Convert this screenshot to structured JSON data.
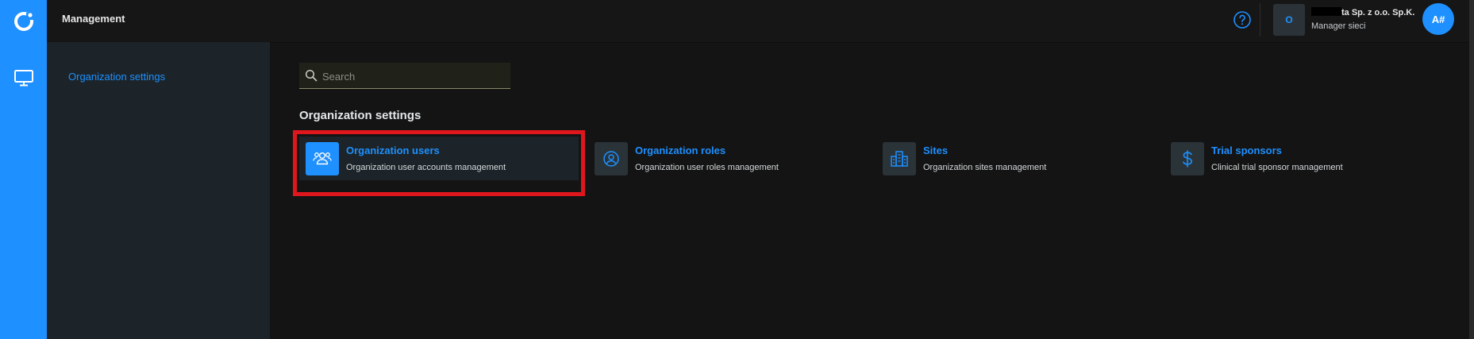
{
  "header": {
    "app_title": "Management",
    "org_initial": "O",
    "org_name": "ta Sp. z o.o. Sp.K.",
    "org_role": "Manager sieci",
    "user_initials": "A#"
  },
  "icons": {
    "logo": "app-logo-icon",
    "nav": "monitor-icon",
    "help": "help-circle-icon",
    "search": "search-icon"
  },
  "sidebar": {
    "items": [
      {
        "label": "Organization settings"
      }
    ]
  },
  "search": {
    "placeholder": "Search",
    "value": ""
  },
  "main": {
    "section_title": "Organization settings",
    "cards": [
      {
        "title": "Organization users",
        "description": "Organization user accounts management",
        "icon": "users-icon",
        "active": true
      },
      {
        "title": "Organization roles",
        "description": "Organization user roles management",
        "icon": "user-circle-icon",
        "active": false
      },
      {
        "title": "Sites",
        "description": "Organization sites management",
        "icon": "buildings-icon",
        "active": false
      },
      {
        "title": "Trial sponsors",
        "description": "Clinical trial sponsor management",
        "icon": "dollar-icon",
        "active": false
      }
    ]
  },
  "colors": {
    "accent": "#1e90ff",
    "highlight": "#e0161d",
    "background": "#141414",
    "sidebar": "#1c2429"
  }
}
